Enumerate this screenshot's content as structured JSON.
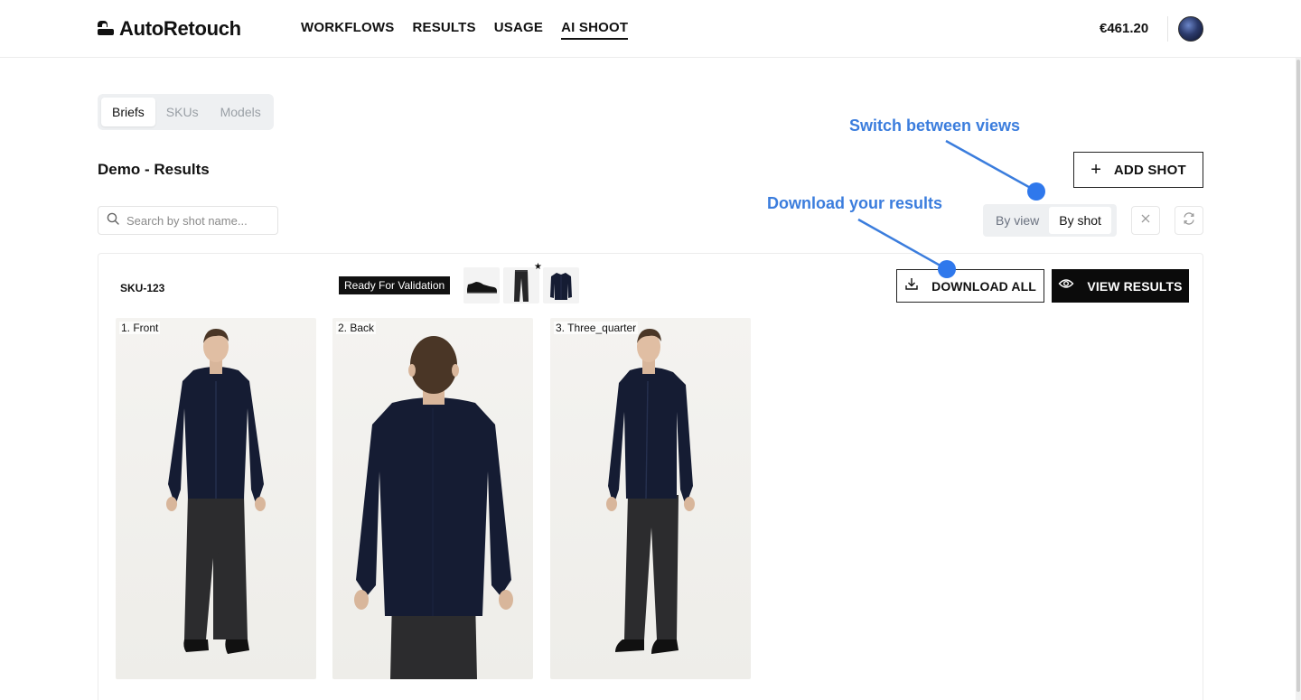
{
  "header": {
    "brand": "AutoRetouch",
    "nav": [
      {
        "label": "WORKFLOWS",
        "active": false
      },
      {
        "label": "RESULTS",
        "active": false
      },
      {
        "label": "USAGE",
        "active": false
      },
      {
        "label": "AI SHOOT",
        "active": true
      }
    ],
    "balance": "€461.20"
  },
  "tabs": [
    {
      "label": "Briefs",
      "active": true
    },
    {
      "label": "SKUs",
      "active": false
    },
    {
      "label": "Models",
      "active": false
    }
  ],
  "page_title": "Demo - Results",
  "add_shot_label": "ADD SHOT",
  "search": {
    "placeholder": "Search by shot name...",
    "value": ""
  },
  "view_toggle": {
    "options": [
      "By view",
      "By shot"
    ],
    "selected": "By shot"
  },
  "shot": {
    "sku": "SKU-123",
    "status": "Ready For Validation",
    "items": [
      {
        "icon": "shoe-thumbnail"
      },
      {
        "icon": "trousers-thumbnail",
        "featured": true
      },
      {
        "icon": "shirt-thumbnail"
      }
    ],
    "download_label": "DOWNLOAD ALL",
    "view_results_label": "VIEW RESULTS",
    "views": [
      {
        "label": "1. Front"
      },
      {
        "label": "2. Back"
      },
      {
        "label": "3. Three_quarter"
      }
    ]
  },
  "annotations": {
    "switch_views": "Switch between views",
    "download_results": "Download your results",
    "color": "#3b7ddd"
  },
  "colors": {
    "accent": "#3b7ddd",
    "primary_button": "#0b0b0b",
    "shirt": "#151c33",
    "jeans": "#2c2c2e"
  }
}
